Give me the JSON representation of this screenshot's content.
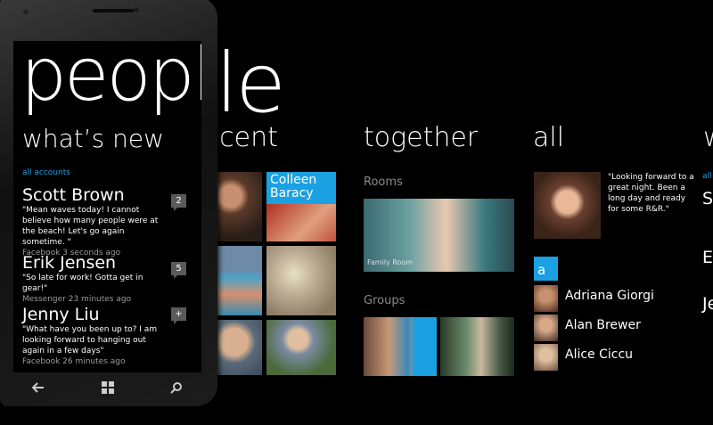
{
  "panorama": {
    "title": "people",
    "sections": {
      "whats_new": "what’s new",
      "recent": "recent",
      "together": "together",
      "all": "all",
      "next_peek": "w"
    },
    "recent_tile_label": "Colleen Baracy",
    "rooms_header": "Rooms",
    "room_caption": "Family Room",
    "groups_header": "Groups",
    "all": {
      "featured_quote": "\"Looking forward to a great night. Been a long day and ready for some R&R.\"",
      "letter": "a",
      "contacts": [
        "Adriana Giorgi",
        "Alan Brewer",
        "Alice Ciccu"
      ]
    },
    "peek": {
      "accounts": "all",
      "names": [
        "S",
        "E",
        "Je"
      ]
    }
  },
  "phone": {
    "title": "people",
    "section": "what’s new",
    "accounts_label": "all accounts",
    "feed": [
      {
        "name": "Scott Brown",
        "message": "\"Mean waves today! I cannot believe how many people were at the beach! Let's go again sometime. \"",
        "meta": "Facebook 3 seconds ago",
        "badge": "2"
      },
      {
        "name": "Erik Jensen",
        "message": "\"So late for work! Gotta get in gear!\"",
        "meta": "Messenger 23 minutes ago",
        "badge": "5"
      },
      {
        "name": "Jenny Liu",
        "message": "\"What have you been up to? I am looking forward to hanging out again in a few days\"",
        "meta": "Facebook 26 minutes ago",
        "badge": "+"
      }
    ],
    "nav": [
      "back-icon",
      "windows-start-icon",
      "search-icon"
    ]
  },
  "colors": {
    "accent": "#1ba1e2",
    "background": "#000000",
    "secondary_text": "#9a9a9a"
  }
}
